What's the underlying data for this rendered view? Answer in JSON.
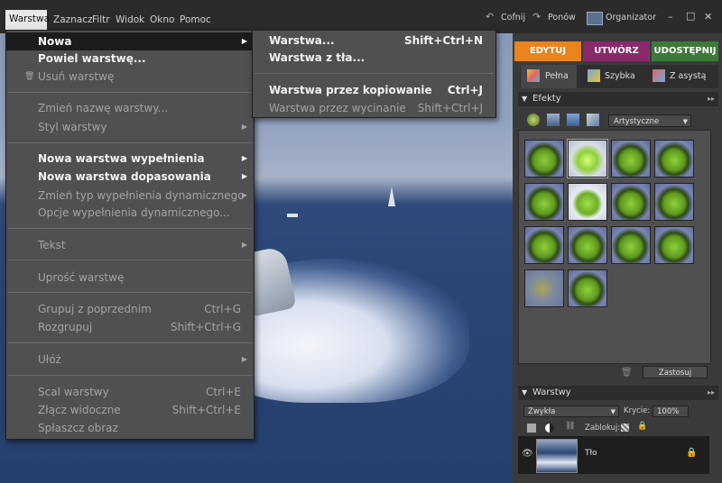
{
  "menubar": {
    "items": [
      "Warstwa",
      "Zaznacz",
      "Filtr",
      "Widok",
      "Okno",
      "Pomoc"
    ],
    "undo": "Cofnij",
    "redo": "Ponów",
    "organizer": "Organizator"
  },
  "window_controls": {
    "minimize": "–",
    "maximize": "□",
    "close": "✕"
  },
  "layer_menu": {
    "new": "Nowa",
    "duplicate": "Powiel warstwę...",
    "delete": "Usuń warstwę",
    "rename": "Zmień nazwę warstwy...",
    "style": "Styl warstwy",
    "new_fill": "Nowa warstwa wypełnienia",
    "new_adjust": "Nowa warstwa dopasowania",
    "change_fill_type": "Zmień typ wypełnienia dynamicznego",
    "fill_options": "Opcje wypełnienia dynamicznego...",
    "text": "Tekst",
    "simplify": "Uprość warstwę",
    "group": "Grupuj z poprzednim",
    "group_sc": "Ctrl+G",
    "ungroup": "Rozgrupuj",
    "ungroup_sc": "Shift+Ctrl+G",
    "arrange": "Ułóż",
    "merge": "Scal warstwy",
    "merge_sc": "Ctrl+E",
    "merge_visible": "Złącz widoczne",
    "merge_visible_sc": "Shift+Ctrl+E",
    "flatten": "Spłaszcz obraz"
  },
  "new_submenu": {
    "layer": "Warstwa...",
    "layer_sc": "Shift+Ctrl+N",
    "from_bg": "Warstwa z tła...",
    "via_copy": "Warstwa przez kopiowanie",
    "via_copy_sc": "Ctrl+J",
    "via_cut": "Warstwa przez wycinanie",
    "via_cut_sc": "Shift+Ctrl+J"
  },
  "mode_tabs": {
    "edit": "EDYTUJ",
    "create": "UTWÓRZ",
    "share": "UDOSTĘPNIJ"
  },
  "mode_colors": {
    "edit": "#e9831c",
    "create": "#8a2a6c",
    "share": "#3d7a3a"
  },
  "edit_modes": {
    "full": "Pełna",
    "quick": "Szybka",
    "guided": "Z asystą"
  },
  "effects": {
    "title": "Efekty",
    "category": "Artystyczne",
    "apply": "Zastosuj",
    "thumb_count": 14
  },
  "layers": {
    "title": "Warstwy",
    "blend_mode": "Zwykła",
    "opacity_label": "Krycie:",
    "opacity_value": "100%",
    "lock_label": "Zablokuj:",
    "layer_name": "Tło"
  }
}
